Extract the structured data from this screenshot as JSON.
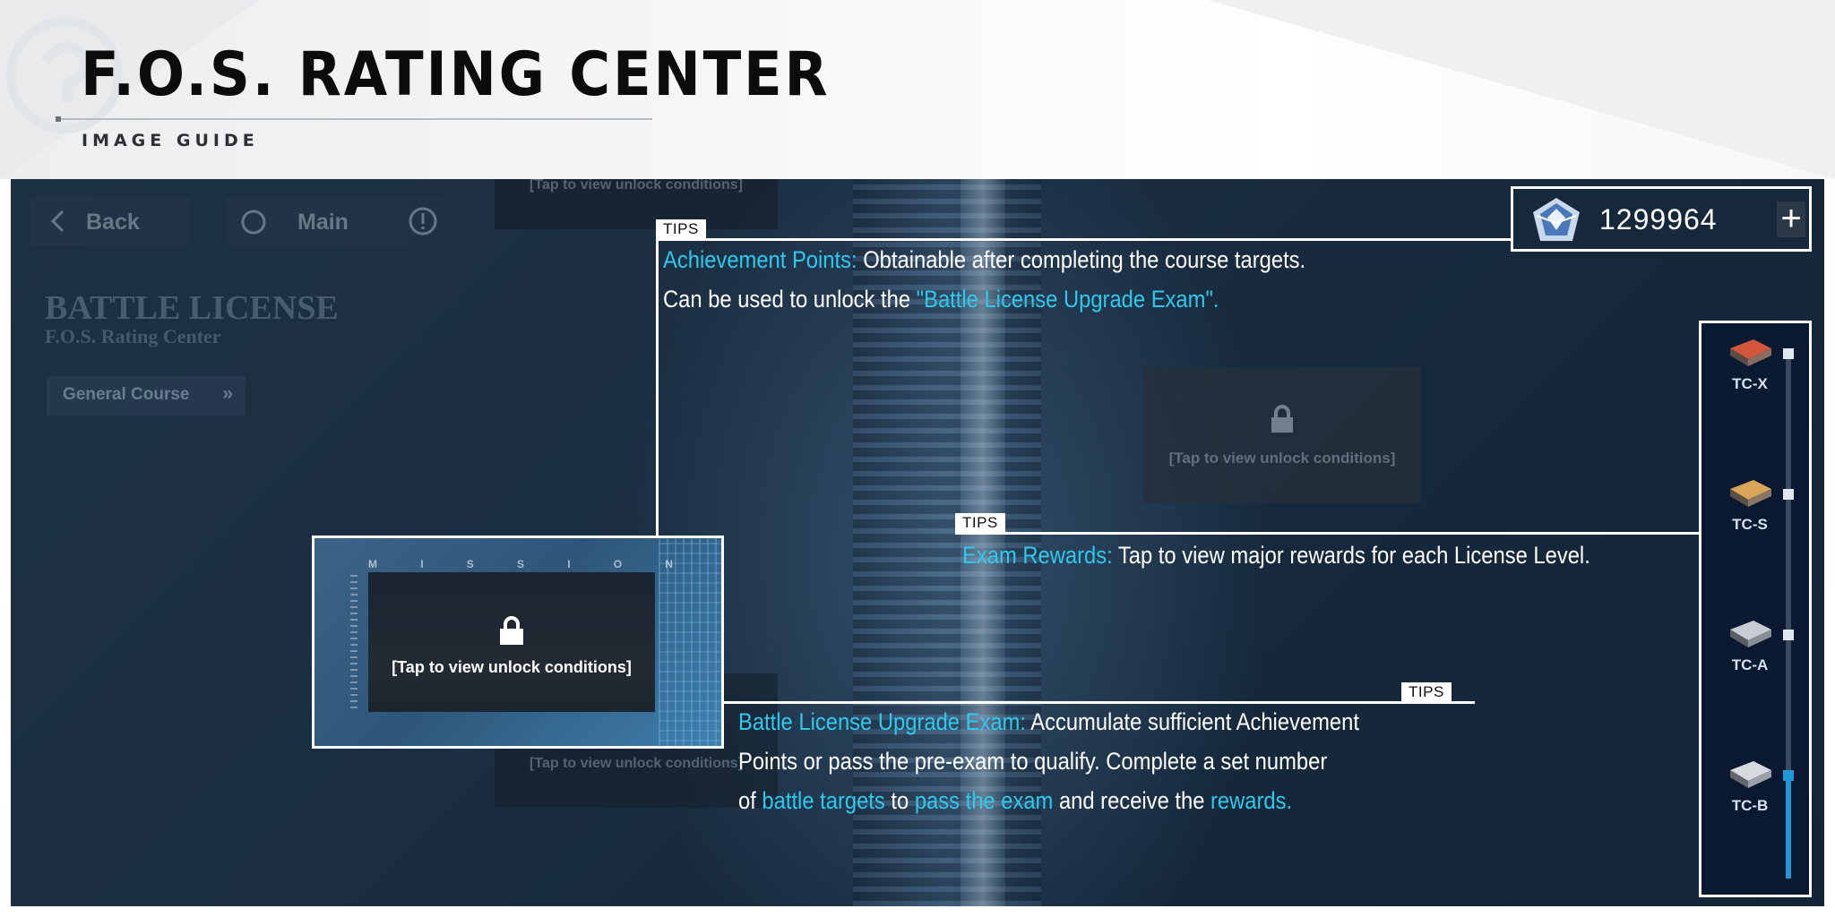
{
  "header": {
    "title": "F.O.S. RATING CENTER",
    "subtitle": "IMAGE GUIDE"
  },
  "game": {
    "nav": {
      "back_label": "Back",
      "main_label": "Main"
    },
    "battle_license_title": "BATTLE LICENSE",
    "battle_license_subtitle": "F.O.S. Rating Center",
    "course_button_label": "General Course",
    "course_button_arrow": "»",
    "currency": {
      "icon": "crystal-icon",
      "value": "1299964",
      "add_label": "+"
    },
    "missions": {
      "locked_text": "[Tap to view unlock conditions]",
      "featured_letters": [
        "M",
        "I",
        "S",
        "S",
        "I",
        "O",
        "N"
      ]
    },
    "tiers": [
      {
        "label": "TC-X",
        "active": false
      },
      {
        "label": "TC-S",
        "active": false
      },
      {
        "label": "TC-A",
        "active": false
      },
      {
        "label": "TC-B",
        "active": true
      }
    ],
    "accent_color": "#2fc9ee"
  },
  "tips": [
    {
      "tag": "TIPS",
      "term": "Achievement Points:",
      "line1_rest": " Obtainable after completing the course targets.",
      "line2_a": "Can be used to unlock the ",
      "line2_hl": "\"Battle License Upgrade Exam\"."
    },
    {
      "tag": "TIPS",
      "term": "Exam Rewards:",
      "line1_rest": " Tap to view major rewards for each License Level."
    },
    {
      "tag": "TIPS",
      "term": "Battle License Upgrade Exam:",
      "line1_rest": " Accumulate sufficient Achievement",
      "line2": "Points or pass the pre-exam to qualify. Complete a set number",
      "line3_a": "of ",
      "line3_hl1": "battle targets",
      "line3_b": " to ",
      "line3_hl2": "pass the exam",
      "line3_c": " and receive the ",
      "line3_hl3": "rewards."
    }
  ]
}
